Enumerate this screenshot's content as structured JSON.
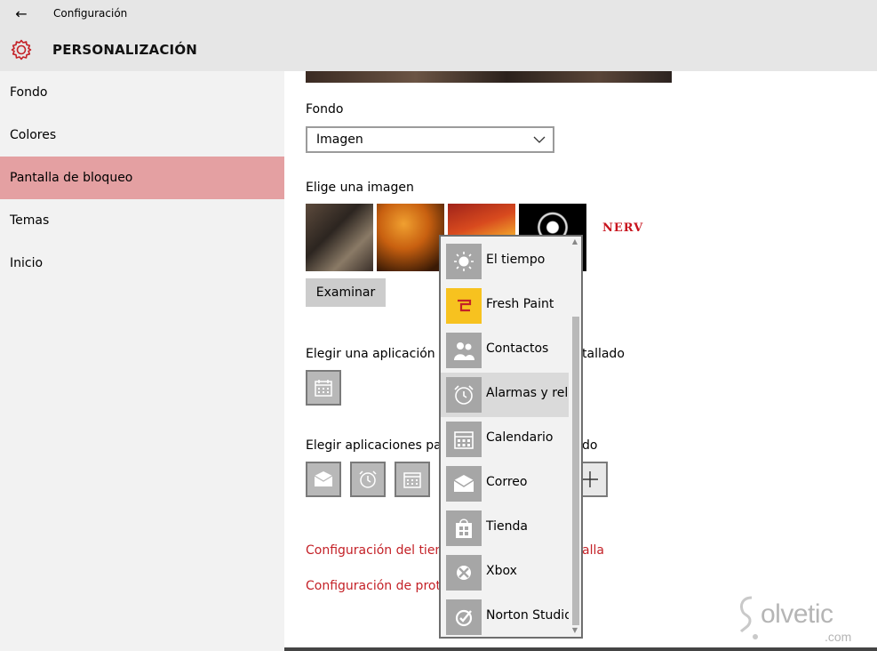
{
  "window": {
    "back_glyph": "←",
    "app_title": "Configuración"
  },
  "header": {
    "section_title": "PERSONALIZACIÓN",
    "icon": "gear-icon",
    "accent_color": "#c42127"
  },
  "sidebar": {
    "items": [
      {
        "label": "Fondo",
        "active": false
      },
      {
        "label": "Colores",
        "active": false
      },
      {
        "label": "Pantalla de bloqueo",
        "active": true
      },
      {
        "label": "Temas",
        "active": false
      },
      {
        "label": "Inicio",
        "active": false
      }
    ],
    "active_color": "#e4a0a2"
  },
  "main": {
    "background_label": "Fondo",
    "background_select": {
      "value": "Imagen"
    },
    "choose_image_label": "Elige una imagen",
    "browse_button": "Examinar",
    "nerv_text": "NERV",
    "detailed_app_label_left": "Elegir una aplicación pa",
    "detailed_app_label_right": "tallado",
    "quick_apps_label_left": "Elegir aplicaciones para",
    "quick_apps_label_right": "do",
    "plus_glyph": "+",
    "link_timeout_left": "Configuración del tiem",
    "link_timeout_right": "alla",
    "link_screensaver": "Configuración de prote"
  },
  "app_picker": {
    "items": [
      {
        "label": "El tiempo",
        "icon": "sun-icon"
      },
      {
        "label": "Fresh Paint",
        "icon": "fresh-paint-icon"
      },
      {
        "label": "Contactos",
        "icon": "people-icon"
      },
      {
        "label": "Alarmas y reloj",
        "icon": "alarm-clock-icon",
        "hovered": true
      },
      {
        "label": "Calendario",
        "icon": "calendar-icon"
      },
      {
        "label": "Correo",
        "icon": "mail-icon"
      },
      {
        "label": "Tienda",
        "icon": "store-icon"
      },
      {
        "label": "Xbox",
        "icon": "xbox-icon"
      },
      {
        "label": "Norton Studio",
        "icon": "norton-icon"
      }
    ],
    "scroll_up": "▲",
    "scroll_down": "▼"
  },
  "watermark": {
    "text": "olvetic",
    "domain": ".com"
  }
}
